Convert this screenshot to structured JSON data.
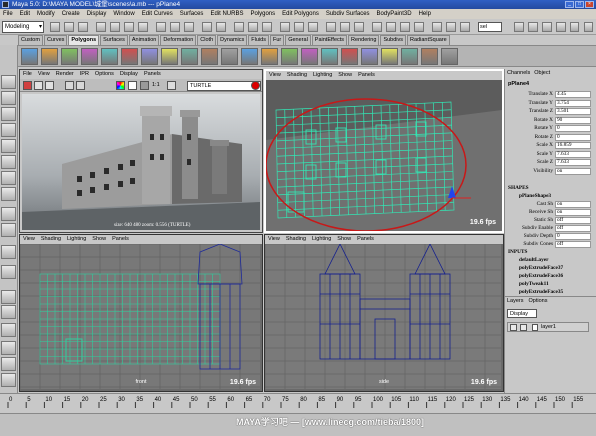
{
  "window": {
    "title": "Maya 5.0: D:\\MAYA MODEL\\城堡\\scenes\\a.mb   ---   pPlane4"
  },
  "menubar": {
    "items": [
      "File",
      "Edit",
      "Modify",
      "Create",
      "Display",
      "Window",
      "Edit Curves",
      "Surfaces",
      "Edit NURBS",
      "Polygons",
      "Edit Polygons",
      "Subdiv Surfaces",
      "BodyPaint3D",
      "Help"
    ]
  },
  "statusline": {
    "menu_set": "Modeling",
    "select_field": "sel"
  },
  "shelf": {
    "tabs": [
      "Custom",
      "Curves",
      "Polygons",
      "Surfaces",
      "Animation",
      "Deformation",
      "Cloth",
      "Dynamics",
      "Fluids",
      "Fur",
      "General",
      "PaintEffects",
      "Rendering",
      "Subdivs",
      "RadiantSquare"
    ],
    "active_tab": "Polygons",
    "icon_count": 22
  },
  "render_view": {
    "menu": [
      "File",
      "View",
      "Render",
      "IPR",
      "Options",
      "Display",
      "Panels"
    ],
    "ratio": "1:1",
    "renderer": "TURTLE",
    "caption": "size:  640  480  zoom: 0.556  (TURTLE)"
  },
  "panes": {
    "persp": {
      "menu": [
        "View",
        "Shading",
        "Lighting",
        "Show",
        "Panels"
      ],
      "fps": "19.6 fps"
    },
    "front": {
      "menu": [
        "View",
        "Shading",
        "Lighting",
        "Show",
        "Panels"
      ],
      "fps": "19.6 fps",
      "camera": "front"
    },
    "side": {
      "menu": [
        "View",
        "Shading",
        "Lighting",
        "Show",
        "Panels"
      ],
      "fps": "19.6 fps",
      "camera": "side"
    }
  },
  "channel_box": {
    "tabs": [
      "Channels",
      "Object"
    ],
    "object": "pPlane4",
    "attributes": [
      {
        "name": "Translate X",
        "value": "4.45"
      },
      {
        "name": "Translate Y",
        "value": "3.754"
      },
      {
        "name": "Translate Z",
        "value": "3.501"
      },
      {
        "name": "Rotate X",
        "value": "90"
      },
      {
        "name": "Rotate Y",
        "value": "0"
      },
      {
        "name": "Rotate Z",
        "value": "0"
      },
      {
        "name": "Scale X",
        "value": "16.859"
      },
      {
        "name": "Scale Y",
        "value": "7.633"
      },
      {
        "name": "Scale Z",
        "value": "7.633"
      },
      {
        "name": "Visibility",
        "value": "on"
      }
    ],
    "shapes_label": "SHAPES",
    "shape_name": "pPlaneShape3",
    "shape_attributes": [
      {
        "name": "Cast Sh",
        "value": "on"
      },
      {
        "name": "Receive Sh",
        "value": "on"
      },
      {
        "name": "Static Sh",
        "value": "off"
      },
      {
        "name": "Subdiv Enable",
        "value": "off"
      },
      {
        "name": "Subdiv Depth",
        "value": "0"
      },
      {
        "name": "Subdiv Cones",
        "value": "off"
      }
    ],
    "inputs_label": "INPUTS",
    "inputs": [
      "defaultLayer",
      "polyExtrudeFace37",
      "polyExtrudeFace36",
      "polyTweak11",
      "polyExtrudeFace35"
    ]
  },
  "layer_editor": {
    "menu": [
      "Layers",
      "Options"
    ],
    "display": "Display",
    "layer_name": "layer1"
  },
  "timeline": {
    "ticks": [
      "0",
      "5",
      "10",
      "15",
      "20",
      "25",
      "30",
      "35",
      "40",
      "45",
      "50",
      "55",
      "60",
      "65",
      "70",
      "75",
      "80",
      "85",
      "90",
      "95",
      "100",
      "105",
      "110",
      "115",
      "120",
      "125",
      "130",
      "135",
      "140",
      "145",
      "150",
      "155"
    ],
    "watermark": "MAYA学习吧 — [www.linecg.com/tieba/1800]"
  }
}
